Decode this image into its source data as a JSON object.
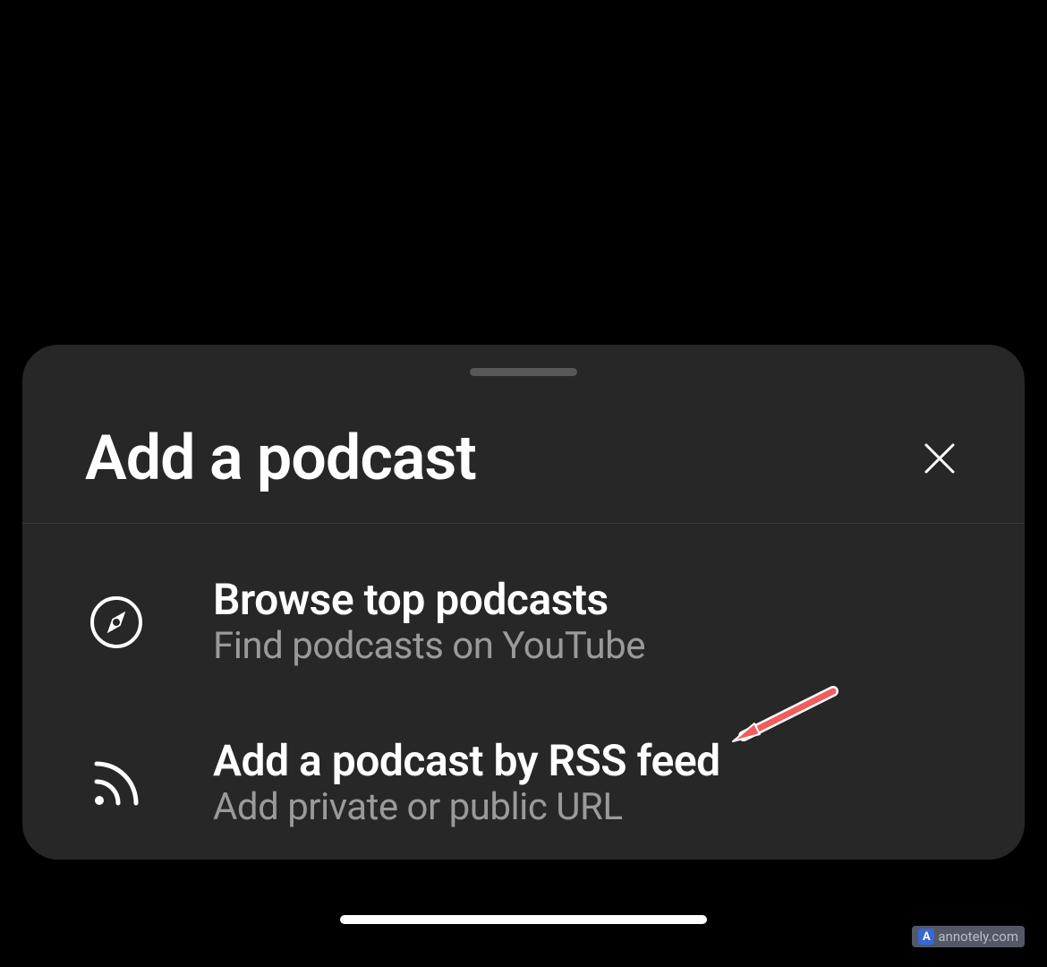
{
  "sheet": {
    "title": "Add a podcast",
    "options": [
      {
        "title": "Browse top podcasts",
        "subtitle": "Find podcasts on YouTube"
      },
      {
        "title": "Add a podcast by RSS feed",
        "subtitle": "Add private or public URL"
      }
    ]
  },
  "watermark": {
    "badge": "A",
    "text": "annotely.com"
  }
}
